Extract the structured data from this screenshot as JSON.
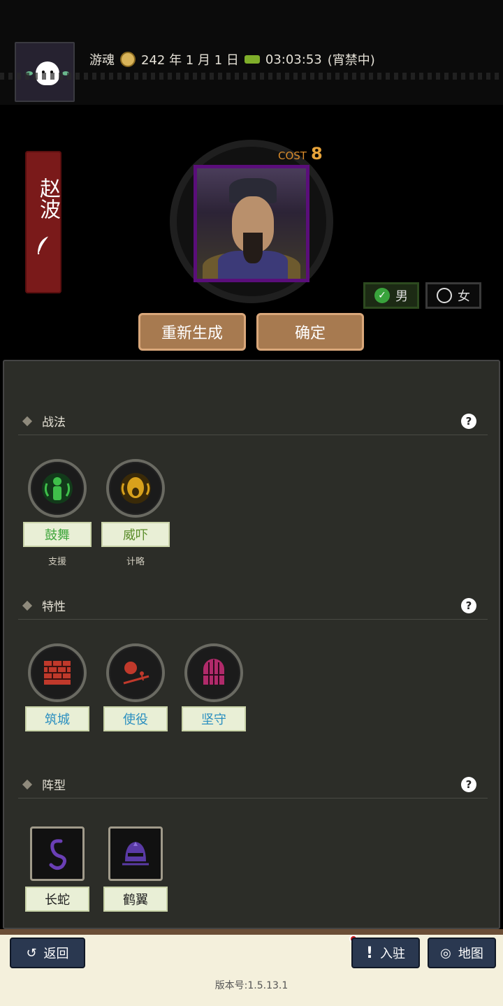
{
  "header": {
    "player_name": "游魂",
    "date": "242 年 1 月 1 日",
    "timer": "03:03:53",
    "timer_status": "(宵禁中)"
  },
  "general": {
    "name": "赵波",
    "cost_label": "COST",
    "cost_value": "8"
  },
  "gender": {
    "male_label": "男",
    "female_label": "女",
    "selected": "male"
  },
  "actions": {
    "regenerate_label": "重新生成",
    "confirm_label": "确定"
  },
  "sections": {
    "tactics": {
      "title": "战法",
      "items": [
        {
          "name": "鼓舞",
          "type": "支援",
          "color": "#3fa63c",
          "icon": "inspire-icon"
        },
        {
          "name": "威吓",
          "type": "计略",
          "color": "#5a8c2a",
          "icon": "intimidate-icon"
        }
      ]
    },
    "traits": {
      "title": "特性",
      "items": [
        {
          "name": "筑城",
          "color": "#2a8fc0",
          "icon": "brick-wall-icon"
        },
        {
          "name": "使役",
          "color": "#2a8fc0",
          "icon": "boulder-icon"
        },
        {
          "name": "坚守",
          "color": "#2a8fc0",
          "icon": "gate-icon"
        }
      ]
    },
    "formations": {
      "title": "阵型",
      "items": [
        {
          "name": "长蛇",
          "icon": "snake-icon"
        },
        {
          "name": "鹤翼",
          "icon": "helmet-icon"
        }
      ]
    }
  },
  "footer": {
    "back_label": "返回",
    "settle_label": "入驻",
    "map_label": "地图",
    "version": "版本号:1.5.13.1"
  }
}
